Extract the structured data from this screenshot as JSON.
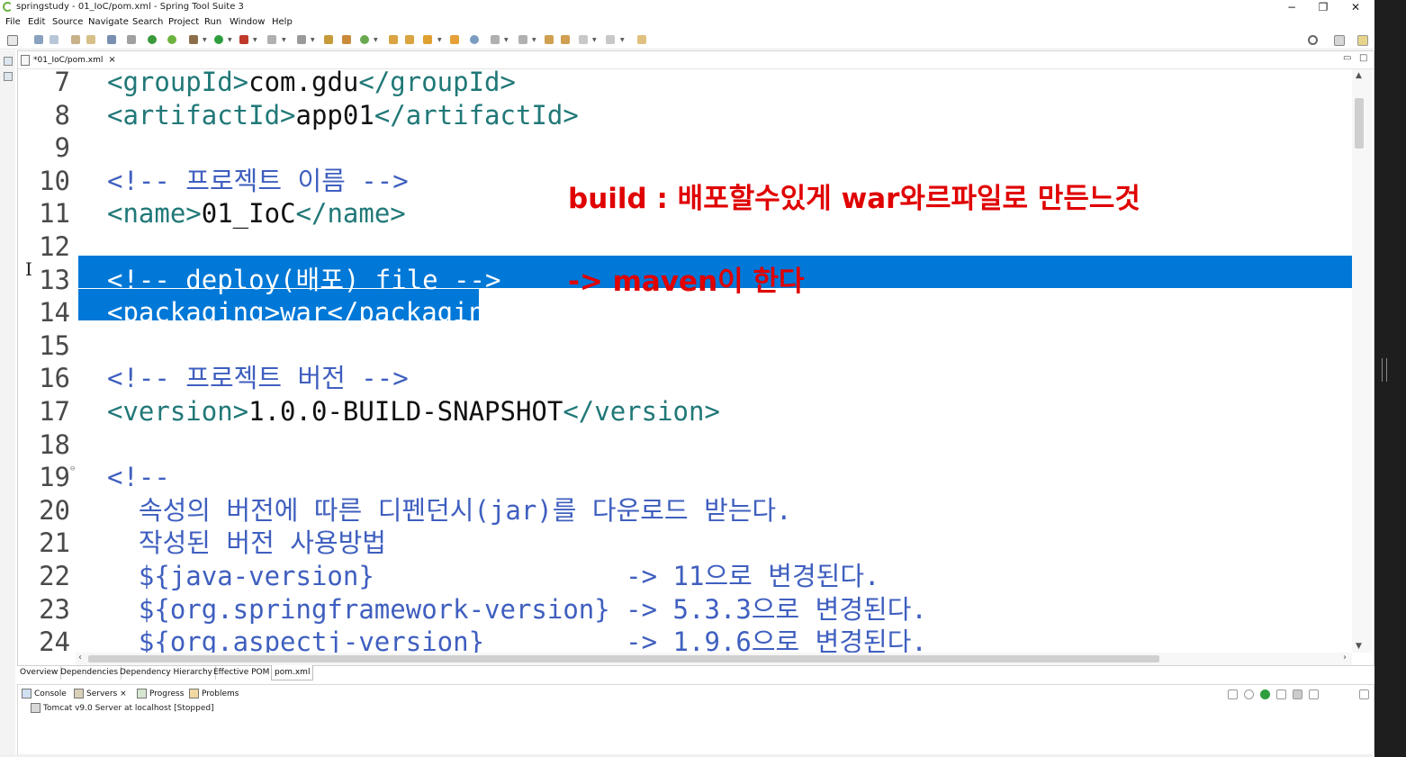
{
  "window": {
    "title": "springstudy - 01_IoC/pom.xml - Spring Tool Suite 3",
    "minimize": "−",
    "restore": "❐",
    "close": "✕"
  },
  "menu": [
    "File",
    "Edit",
    "Source",
    "Navigate",
    "Search",
    "Project",
    "Run",
    "Window",
    "Help"
  ],
  "editor": {
    "tab_label": "*01_IoC/pom.xml",
    "tab_close": "×",
    "lines": [
      {
        "num": "7",
        "parts": [
          {
            "t": "<groupId>",
            "c": "tag"
          },
          {
            "t": "com.gdu",
            "c": "txt"
          },
          {
            "t": "</groupId>",
            "c": "tag"
          }
        ]
      },
      {
        "num": "8",
        "parts": [
          {
            "t": "<artifactId>",
            "c": "tag"
          },
          {
            "t": "app01",
            "c": "txt"
          },
          {
            "t": "</artifactId>",
            "c": "tag"
          }
        ]
      },
      {
        "num": "9",
        "parts": []
      },
      {
        "num": "10",
        "parts": [
          {
            "t": "<!-- 프로젝트 이름 -->",
            "c": "cmt"
          }
        ]
      },
      {
        "num": "11",
        "parts": [
          {
            "t": "<name>",
            "c": "tag"
          },
          {
            "t": "01_IoC",
            "c": "txt"
          },
          {
            "t": "</name>",
            "c": "tag"
          }
        ]
      },
      {
        "num": "12",
        "parts": []
      },
      {
        "num": "13",
        "parts": [
          {
            "t": "<!-- deploy(배포) file -->",
            "c": "cmt"
          }
        ]
      },
      {
        "num": "14",
        "parts": [
          {
            "t": "<packaging>",
            "c": "tag"
          },
          {
            "t": "war",
            "c": "txt"
          },
          {
            "t": "</packaging>",
            "c": "tag"
          }
        ]
      },
      {
        "num": "15",
        "parts": []
      },
      {
        "num": "16",
        "parts": [
          {
            "t": "<!-- 프로젝트 버전 -->",
            "c": "cmt"
          }
        ]
      },
      {
        "num": "17",
        "parts": [
          {
            "t": "<version>",
            "c": "tag"
          },
          {
            "t": "1.0.0-BUILD-SNAPSHOT",
            "c": "txt"
          },
          {
            "t": "</version>",
            "c": "tag"
          }
        ]
      },
      {
        "num": "18",
        "parts": []
      },
      {
        "num": "19",
        "parts": [
          {
            "t": "<!--",
            "c": "cmt"
          }
        ]
      },
      {
        "num": "20",
        "parts": [
          {
            "t": "  속성의 버전에 따른 디펜던시(jar)를 다운로드 받는다.",
            "c": "cmt"
          }
        ]
      },
      {
        "num": "21",
        "parts": [
          {
            "t": "  작성된 버전 사용방법",
            "c": "cmt"
          }
        ]
      },
      {
        "num": "22",
        "parts": [
          {
            "t": "  ${java-version}                -> 11으로 변경된다.",
            "c": "cmt"
          }
        ]
      },
      {
        "num": "23",
        "parts": [
          {
            "t": "  ${org.springframework-version} -> 5.3.3으로 변경된다.",
            "c": "cmt"
          }
        ]
      },
      {
        "num": "24",
        "parts": [
          {
            "t": "  ${org.aspectj-version}         -> 1.9.6으로 변경된다.",
            "c": "cmt"
          }
        ]
      }
    ],
    "annotation_build": "build : 배포할수있게 war와르파일로 만든느것",
    "annotation_maven": "-> maven이 한다"
  },
  "pom_tabs": [
    "Overview",
    "Dependencies",
    "Dependency Hierarchy",
    "Effective POM",
    "pom.xml"
  ],
  "bottom": {
    "tabs": [
      "Console",
      "Servers",
      "Progress",
      "Problems"
    ],
    "servers_close": "×",
    "server_entry": "Tomcat v9.0 Server at localhost  [Stopped]"
  },
  "colors": {
    "selection": "#0078d7",
    "tag": "#217878",
    "comment": "#3f5fbf",
    "annotation": "#e00000"
  }
}
